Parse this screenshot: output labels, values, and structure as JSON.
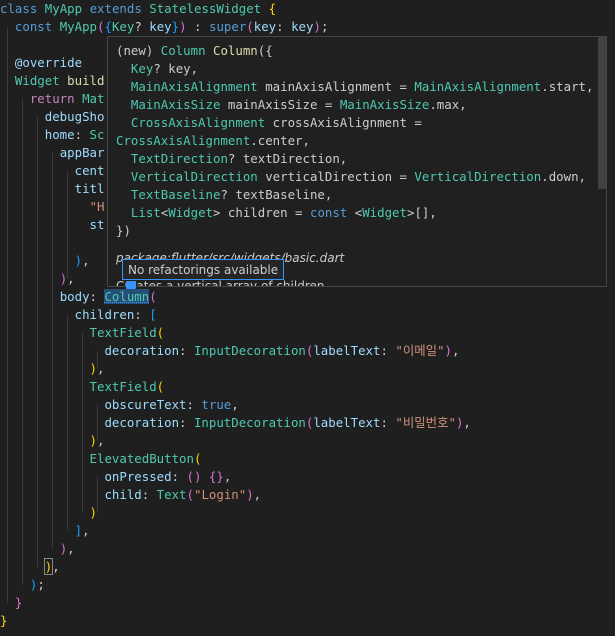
{
  "editor": {
    "lines": [
      "class MyApp extends StatelessWidget {",
      "  const MyApp({Key? key}) : super(key: key);",
      "",
      "  @override",
      "  Widget build",
      "    return Mat",
      "      debugSho",
      "      home: Sc",
      "        appBar",
      "          cent",
      "          titl",
      "            \"H",
      "            st",
      "",
      "          ),",
      "        ),",
      "        body: Column(",
      "          children: [",
      "            TextField(",
      "              decoration: InputDecoration(labelText: \"이메일\"),",
      "            ),",
      "            TextField(",
      "              obscureText: true,",
      "              decoration: InputDecoration(labelText: \"비밀번호\"),",
      "            ),",
      "            ElevatedButton(",
      "              onPressed: () {},",
      "              child: Text(\"Login\"),",
      "            )",
      "          ],",
      "        ),",
      "      ),",
      "    );",
      "  }",
      "}"
    ]
  },
  "hover": {
    "signature_lines": [
      "(new) Column Column({",
      "  Key? key,",
      "  MainAxisAlignment mainAxisAlignment = MainAxisAlignment.start,",
      "  MainAxisSize mainAxisSize = MainAxisSize.max,",
      "  CrossAxisAlignment crossAxisAlignment =",
      "CrossAxisAlignment.center,",
      "  TextDirection? textDirection,",
      "  VerticalDirection verticalDirection = VerticalDirection.down,",
      "  TextBaseline? textBaseline,",
      "  List<Widget> children = const <Widget>[],",
      "})"
    ],
    "package": "package:flutter/src/widgets/basic.dart",
    "doc": "Creates a vertical array of children."
  },
  "tooltip": {
    "text": "No refactorings available"
  },
  "colors": {
    "background": "#1f1f1f",
    "keyword": "#569cd6",
    "type": "#4ec9b0",
    "property": "#9cdcfe",
    "string": "#ce9178",
    "accent": "#3794ff"
  }
}
